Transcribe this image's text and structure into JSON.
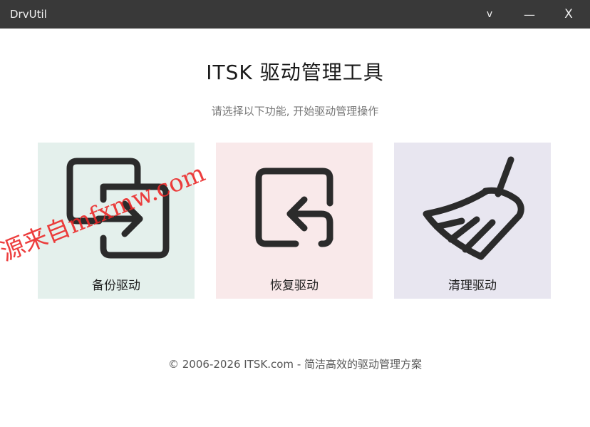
{
  "window": {
    "title": "DrvUtil",
    "collapse_glyph": "v",
    "minimize_glyph": "—",
    "close_glyph": "X"
  },
  "header": {
    "title": "ITSK 驱动管理工具",
    "subtitle": "请选择以下功能, 开始驱动管理操作"
  },
  "cards": [
    {
      "label": "备份驱动",
      "icon": "backup-icon",
      "bg": "#e4f0ec"
    },
    {
      "label": "恢复驱动",
      "icon": "restore-icon",
      "bg": "#f9e9ea"
    },
    {
      "label": "清理驱动",
      "icon": "broom-icon",
      "bg": "#e8e6f0"
    }
  ],
  "footer": {
    "text": "© 2006-2026 ITSK.com - 简洁高效的驱动管理方案"
  },
  "watermark": {
    "text": "源来自mfxmw.com"
  },
  "colors": {
    "titlebar": "#393939",
    "icon_stroke": "#2b2b2b"
  }
}
